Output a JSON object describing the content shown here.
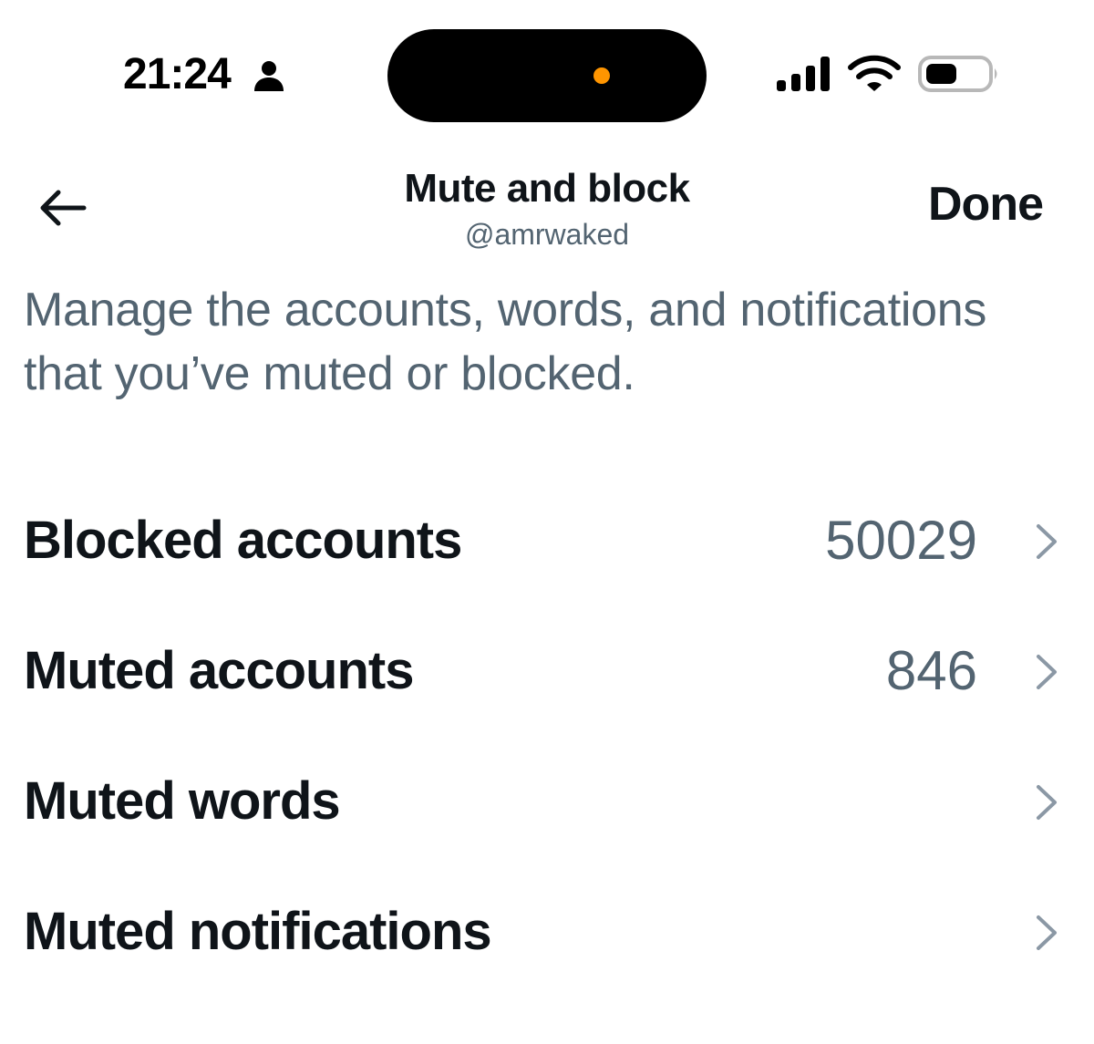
{
  "status_bar": {
    "time": "21:24",
    "icons": [
      "person-icon",
      "signal-icon",
      "wifi-icon",
      "battery-icon"
    ],
    "island_dot_color": "#ff9500"
  },
  "header": {
    "back_icon": "arrow-left-icon",
    "title": "Mute and block",
    "subtitle": "@amrwaked",
    "done_label": "Done"
  },
  "description": "Manage the accounts, words, and notifications that you’ve muted or blocked.",
  "settings": [
    {
      "label": "Blocked accounts",
      "count": "50029",
      "icon": "chevron-right-icon"
    },
    {
      "label": "Muted accounts",
      "count": "846",
      "icon": "chevron-right-icon"
    },
    {
      "label": "Muted words",
      "count": "",
      "icon": "chevron-right-icon"
    },
    {
      "label": "Muted notifications",
      "count": "",
      "icon": "chevron-right-icon"
    }
  ],
  "colors": {
    "primary_text": "#0f1419",
    "secondary_text": "#536471",
    "chevron": "#8b98a5",
    "background": "#ffffff"
  }
}
